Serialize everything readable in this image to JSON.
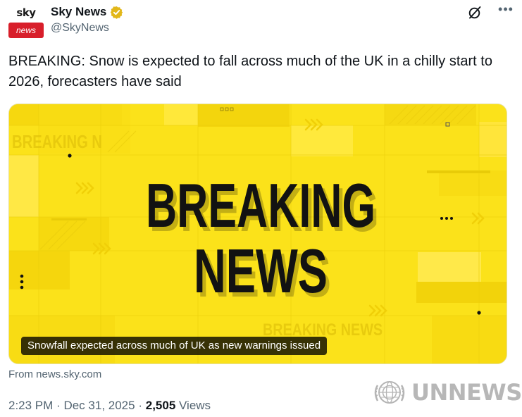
{
  "account": {
    "avatar_top": "sky",
    "avatar_bottom": "news",
    "display_name": "Sky News",
    "handle": "@SkyNews"
  },
  "tweet": {
    "text": "BREAKING: Snow is expected to fall across much of the UK in a chilly start to 2026, forecasters have said"
  },
  "card": {
    "image_headline_line1": "BREAKING",
    "image_headline_line2": "NEWS",
    "image_bg_text_1": "BREAKING N",
    "image_bg_text_2": "BREAKING NEWS",
    "caption": "Snowfall expected across much of UK as new warnings issued",
    "source": "From news.sky.com"
  },
  "meta": {
    "time": "2:23 PM",
    "separator": "·",
    "date": "Dec 31, 2025",
    "views_count": "2,505",
    "views_label": "Views"
  },
  "watermark": {
    "text": "UNNEWS"
  },
  "icons": {
    "verified": "verified-badge-icon",
    "grok": "grok-icon",
    "more": "more-icon"
  },
  "colors": {
    "card_yellow": "#fbe21a",
    "verified_gold": "#e2b719",
    "avatar_red": "#d81e2a"
  }
}
